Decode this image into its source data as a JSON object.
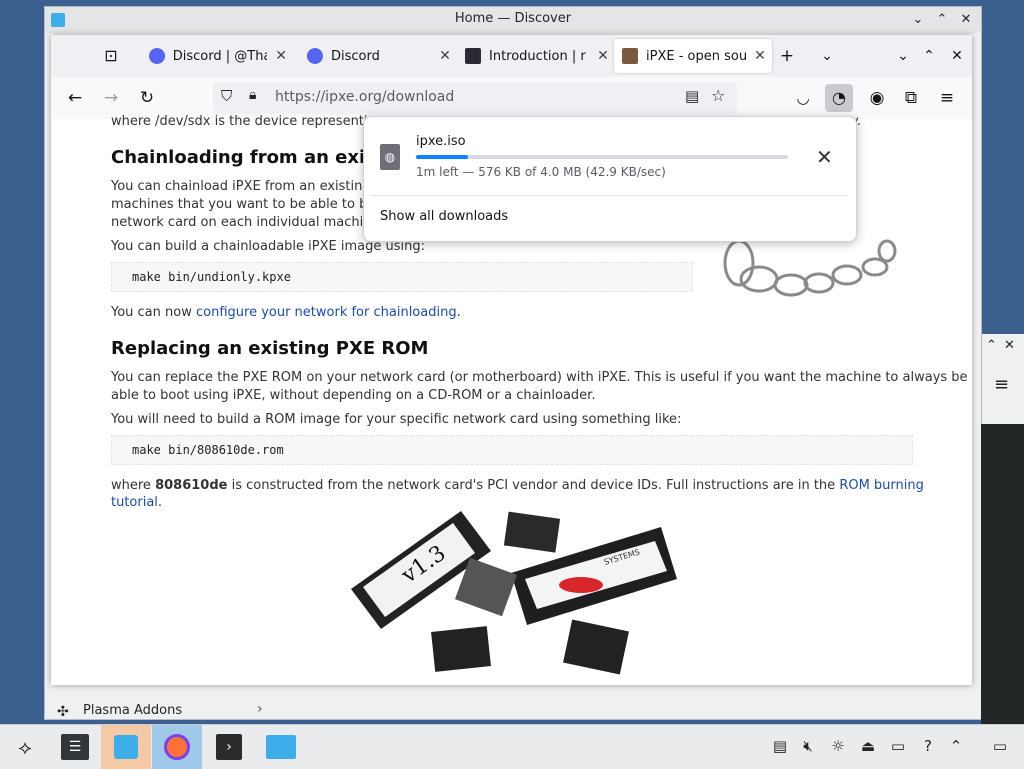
{
  "discover": {
    "title": "Home — Discover",
    "plasma_addons": "Plasma Addons"
  },
  "firefox": {
    "tabs": [
      {
        "title": "Discord | @Tha",
        "icon": "discord-icon"
      },
      {
        "title": "Discord",
        "icon": "discord-icon"
      },
      {
        "title": "Introduction | r",
        "icon": "terminal-icon"
      },
      {
        "title": "iPXE - open sou",
        "icon": "ipxe-icon"
      }
    ],
    "url": "https://ipxe.org/download"
  },
  "page": {
    "partial_line": "where /dev/sdx is the device representin",
    "partial_line_end": "y.",
    "chainloading": {
      "heading": "Chainloading from an existin",
      "para1_l1": "You can chainload iPXE from an existing P",
      "para1_l2": "machines that you want to be able to boo",
      "para1_l3": "network card on each individual machine.",
      "para2": "You can build a chainloadable iPXE image using:",
      "code": "make bin/undionly.kpxe",
      "now_prefix": "You can now ",
      "now_link": "configure your network for chainloading",
      "now_suffix": "."
    },
    "rom": {
      "heading": "Replacing an existing PXE ROM",
      "para1_l1": "You can replace the PXE ROM on your network card (or motherboard) with iPXE. This is useful if you want the machine to always be",
      "para1_l2": "able to boot using iPXE, without depending on a CD-ROM or a chainloader.",
      "para2": "You will need to build a ROM image for your specific network card using something like:",
      "code": "make bin/808610de.rom",
      "where_prefix": "where ",
      "where_bold": "808610de",
      "where_mid": " is constructed from the network card's PCI vendor and device IDs. Full instructions are in the ",
      "where_link": "ROM burning tutorial",
      "where_suffix": ".",
      "chip_label": "v1.3",
      "chip_label2": "SYSTEMS"
    }
  },
  "downloads": {
    "filename": "ipxe.iso",
    "status": "1m left — 576 KB of 4.0 MB (42.9 KB/sec)",
    "progress": 0.14,
    "show_all": "Show all downloads"
  },
  "colors": {
    "accent": "#0a84ff",
    "link": "#1a4bb4",
    "discord": "#5865f2"
  }
}
